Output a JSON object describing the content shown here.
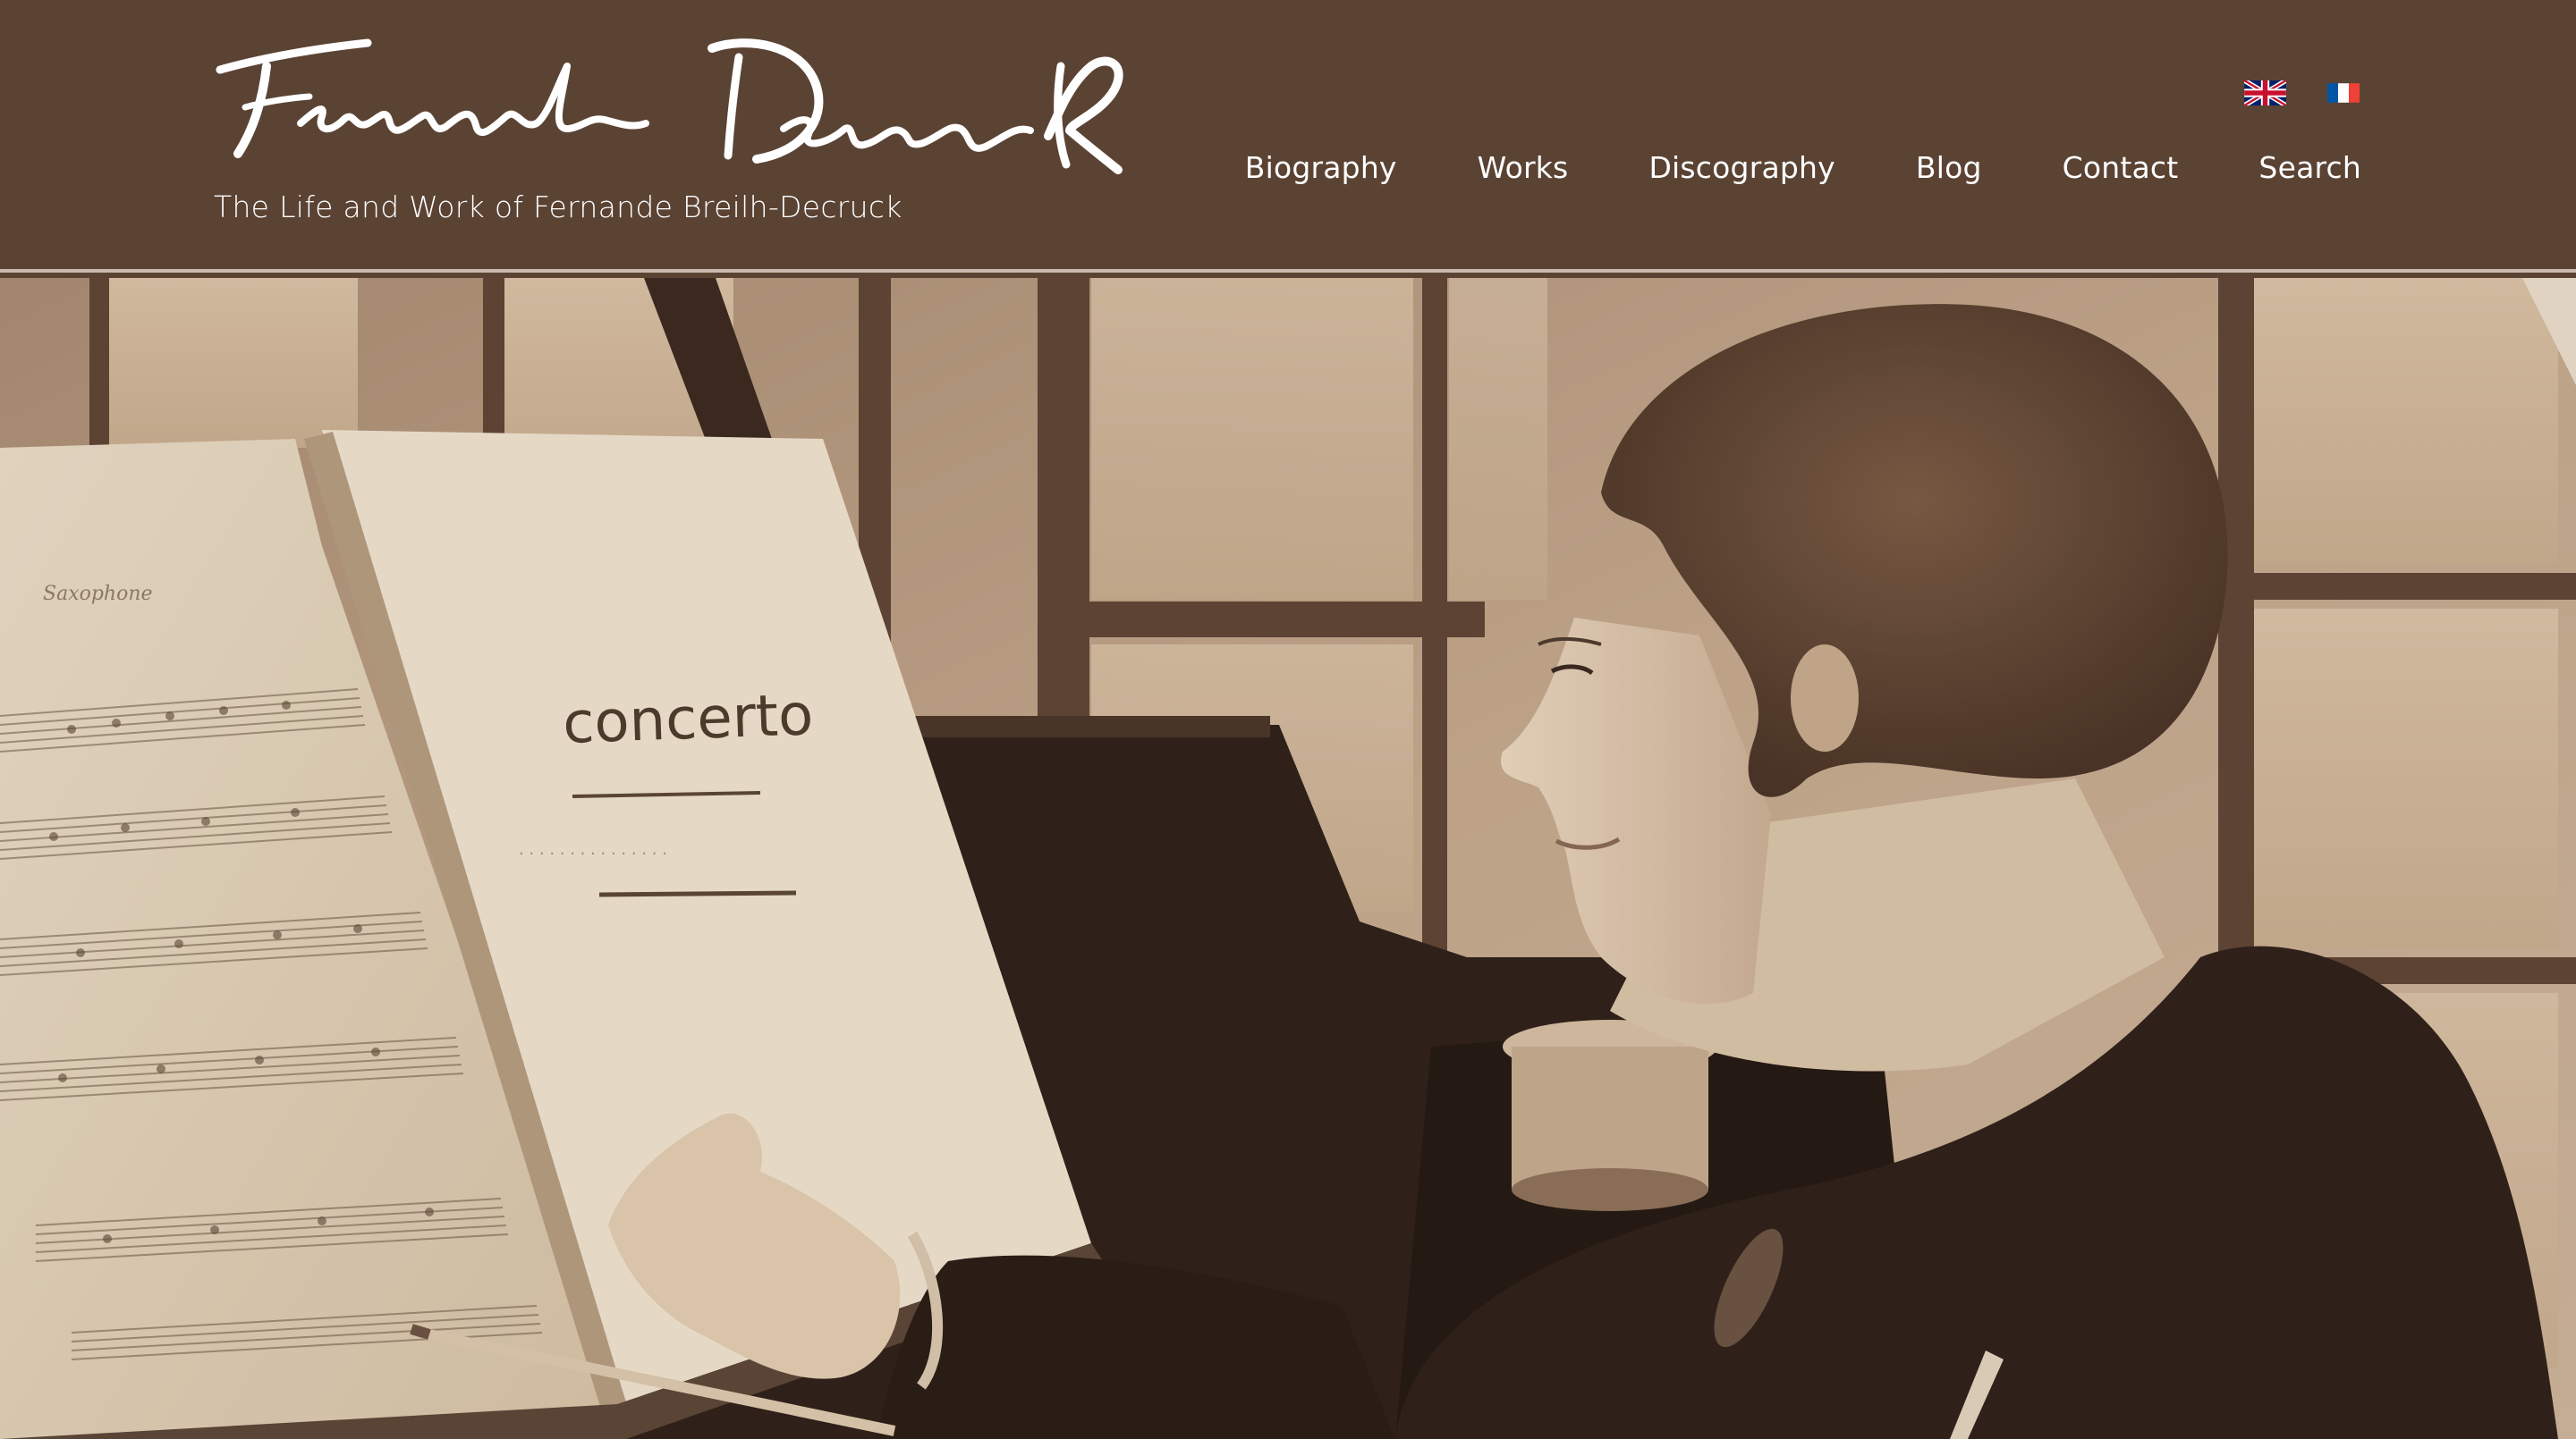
{
  "site": {
    "logo_signature": "Fernande Decruck",
    "tagline": "The Life and Work of Fernande Breilh-Decruck"
  },
  "languages": [
    {
      "name": "English",
      "icon": "uk-flag-icon"
    },
    {
      "name": "Français",
      "icon": "french-flag-icon"
    }
  ],
  "nav": {
    "items": [
      {
        "label": "Biography"
      },
      {
        "label": "Works"
      },
      {
        "label": "Discography"
      },
      {
        "label": "Blog"
      },
      {
        "label": "Contact"
      },
      {
        "label": "Search"
      }
    ]
  },
  "hero": {
    "image": "sepia photograph of a woman at a piano pointing a pencil at an open music score",
    "score_title": "concerto"
  },
  "colors": {
    "header_bg": "#5b4334",
    "text": "#ffffff",
    "rule": "#c9bbae",
    "sepia_light": "#e6d6bf",
    "sepia_dark": "#3a2a21"
  }
}
